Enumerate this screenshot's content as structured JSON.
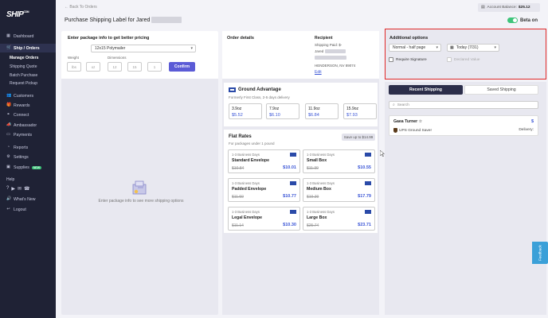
{
  "sidebar": {
    "logo": "SHIP",
    "logo_suffix": "COM",
    "items": [
      {
        "label": "Dashboard",
        "icon": "grid-icon"
      },
      {
        "label": "Ship / Orders",
        "icon": "cart-icon"
      },
      {
        "label": "Customers",
        "icon": "people-icon"
      },
      {
        "label": "Rewards",
        "icon": "gift-icon"
      },
      {
        "label": "Connect",
        "icon": "link-icon"
      },
      {
        "label": "Ambassador",
        "icon": "megaphone-icon"
      },
      {
        "label": "Payments",
        "icon": "card-icon"
      },
      {
        "label": "Reports",
        "icon": "chart-icon"
      },
      {
        "label": "Settings",
        "icon": "gear-icon"
      },
      {
        "label": "Supplies",
        "icon": "box-icon",
        "badge": "NEW"
      },
      {
        "label": "What's New",
        "icon": "speaker-icon"
      },
      {
        "label": "Logout",
        "icon": "logout-icon"
      }
    ],
    "subitems": [
      "Manage Orders",
      "Shipping Quote",
      "Batch Purchase",
      "Request Pickup"
    ],
    "help_label": "Help"
  },
  "header": {
    "back_link": "← Back To Orders",
    "title": "Purchase Shipping Label for Jared",
    "balance_label": "Account Balance:",
    "balance_value": "$25.12",
    "beta_label": "Beta on"
  },
  "package": {
    "title": "Enter package info to get better pricing",
    "package_type": "12x15 Polymailer",
    "weight_label": "Weight",
    "dimensions_label": "Dimensions",
    "weight_lbs": "lbs",
    "weight_oz": "oz",
    "dim_l": "12",
    "dim_w": "15",
    "dim_h": "1",
    "confirm_label": "Confirm",
    "empty_text": "Enter package info to see more shipping options"
  },
  "order": {
    "title": "Order details",
    "recipient_label": "Recipient",
    "recipient_line1": "Shipping Paid: $-",
    "recipient_line2": "Jared",
    "recipient_city": "HENDERSON, NV 89074",
    "edit_label": "Edit"
  },
  "ground_advantage": {
    "title": "Ground Advantage",
    "subtitle": "Formerly First Class, 2-5 days delivery",
    "weights": [
      {
        "weight": "3.9oz",
        "price": "$5.52"
      },
      {
        "weight": "7.9oz",
        "price": "$6.10"
      },
      {
        "weight": "11.9oz",
        "price": "$6.84"
      },
      {
        "weight": "15.9oz",
        "price": "$7.93"
      }
    ]
  },
  "flat_rates": {
    "title": "Flat Rates",
    "subtitle": "For packages under 1 pound",
    "save_label": "Save up to $14.99",
    "boxes": [
      {
        "days": "1-3 Business Days",
        "name": "Standard Envelope",
        "old": "$10.84",
        "new": "$10.01"
      },
      {
        "days": "1-3 Business Days",
        "name": "Small Box",
        "old": "$11.39",
        "new": "$10.55"
      },
      {
        "days": "1-3 Business Days",
        "name": "Padded Envelope",
        "old": "$11.59",
        "new": "$10.77"
      },
      {
        "days": "1-3 Business Days",
        "name": "Medium Box",
        "old": "$19.39",
        "new": "$17.79"
      },
      {
        "days": "1-3 Business Days",
        "name": "Legal Envelope",
        "old": "$11.14",
        "new": "$10.30"
      },
      {
        "days": "1-3 Business Days",
        "name": "Large Box",
        "old": "$25.74",
        "new": "$23.71"
      }
    ]
  },
  "additional": {
    "title": "Additional options",
    "label_size": "Normal - half page",
    "ship_date": "Today (7/31)",
    "require_signature": "Require Signature",
    "declared_value": "Declared Value"
  },
  "right": {
    "tab_recent": "Recent Shipping",
    "tab_saved": "Saved Shipping",
    "search_placeholder": "Search",
    "recent_name": "Gaea Turner",
    "recent_service": "UPS Ground Saver",
    "recent_price": "$",
    "recent_delivery": "Delivery:"
  },
  "feedback_label": "Feedback",
  "colors": {
    "accent": "#5b5bd6",
    "sidebar": "#1f2235",
    "highlight_border": "#e02828",
    "price": "#3a55d6",
    "toggle_on": "#3ec47a"
  }
}
